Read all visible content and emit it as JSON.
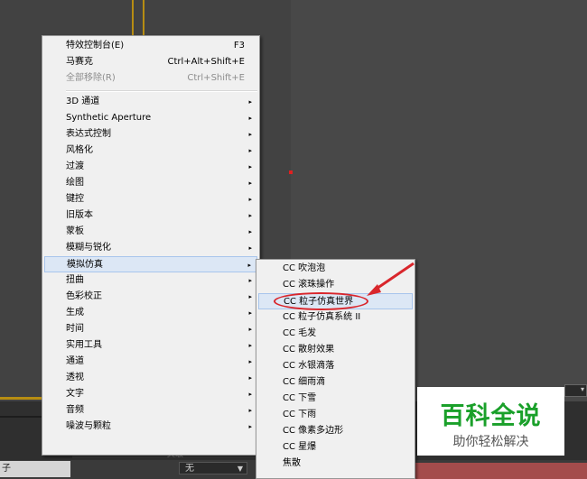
{
  "bottom_panel": {
    "layer_label": "子",
    "mode_value": "无",
    "toolbar_label": "父级"
  },
  "context_menu": {
    "items": [
      {
        "label": "特效控制台(E)",
        "shortcut": "F3"
      },
      {
        "label": "马赛克",
        "shortcut": "Ctrl+Alt+Shift+E"
      },
      {
        "label": "全部移除(R)",
        "shortcut": "Ctrl+Shift+E"
      },
      {
        "label": "3D 通道"
      },
      {
        "label": "Synthetic Aperture"
      },
      {
        "label": "表达式控制"
      },
      {
        "label": "风格化"
      },
      {
        "label": "过渡"
      },
      {
        "label": "绘图"
      },
      {
        "label": "键控"
      },
      {
        "label": "旧版本"
      },
      {
        "label": "蒙板"
      },
      {
        "label": "模糊与锐化"
      },
      {
        "label": "模拟仿真"
      },
      {
        "label": "扭曲"
      },
      {
        "label": "色彩校正"
      },
      {
        "label": "生成"
      },
      {
        "label": "时间"
      },
      {
        "label": "实用工具"
      },
      {
        "label": "通道"
      },
      {
        "label": "透视"
      },
      {
        "label": "文字"
      },
      {
        "label": "音频"
      },
      {
        "label": "噪波与颗粒"
      }
    ],
    "submenu_arrow": "▸"
  },
  "submenu": {
    "items": [
      {
        "label": "CC 吹泡泡"
      },
      {
        "label": "CC 滚珠操作"
      },
      {
        "label": "CC 粒子仿真世界"
      },
      {
        "label": "CC 粒子仿真系统 II"
      },
      {
        "label": "CC 毛发"
      },
      {
        "label": "CC 散射效果"
      },
      {
        "label": "CC 水银滴落"
      },
      {
        "label": "CC 细雨滴"
      },
      {
        "label": "CC 下雪"
      },
      {
        "label": "CC 下雨"
      },
      {
        "label": "CC 像素多边形"
      },
      {
        "label": "CC 星爆"
      },
      {
        "label": "焦散"
      }
    ]
  },
  "watermark": {
    "title": "百科全说",
    "subtitle": "助你轻松解决"
  },
  "colors": {
    "menu_bg": "#f0f0f0",
    "hover_bg": "#dce7f5",
    "annotation_red": "#d9262c",
    "watermark_green": "#1aa02a"
  }
}
